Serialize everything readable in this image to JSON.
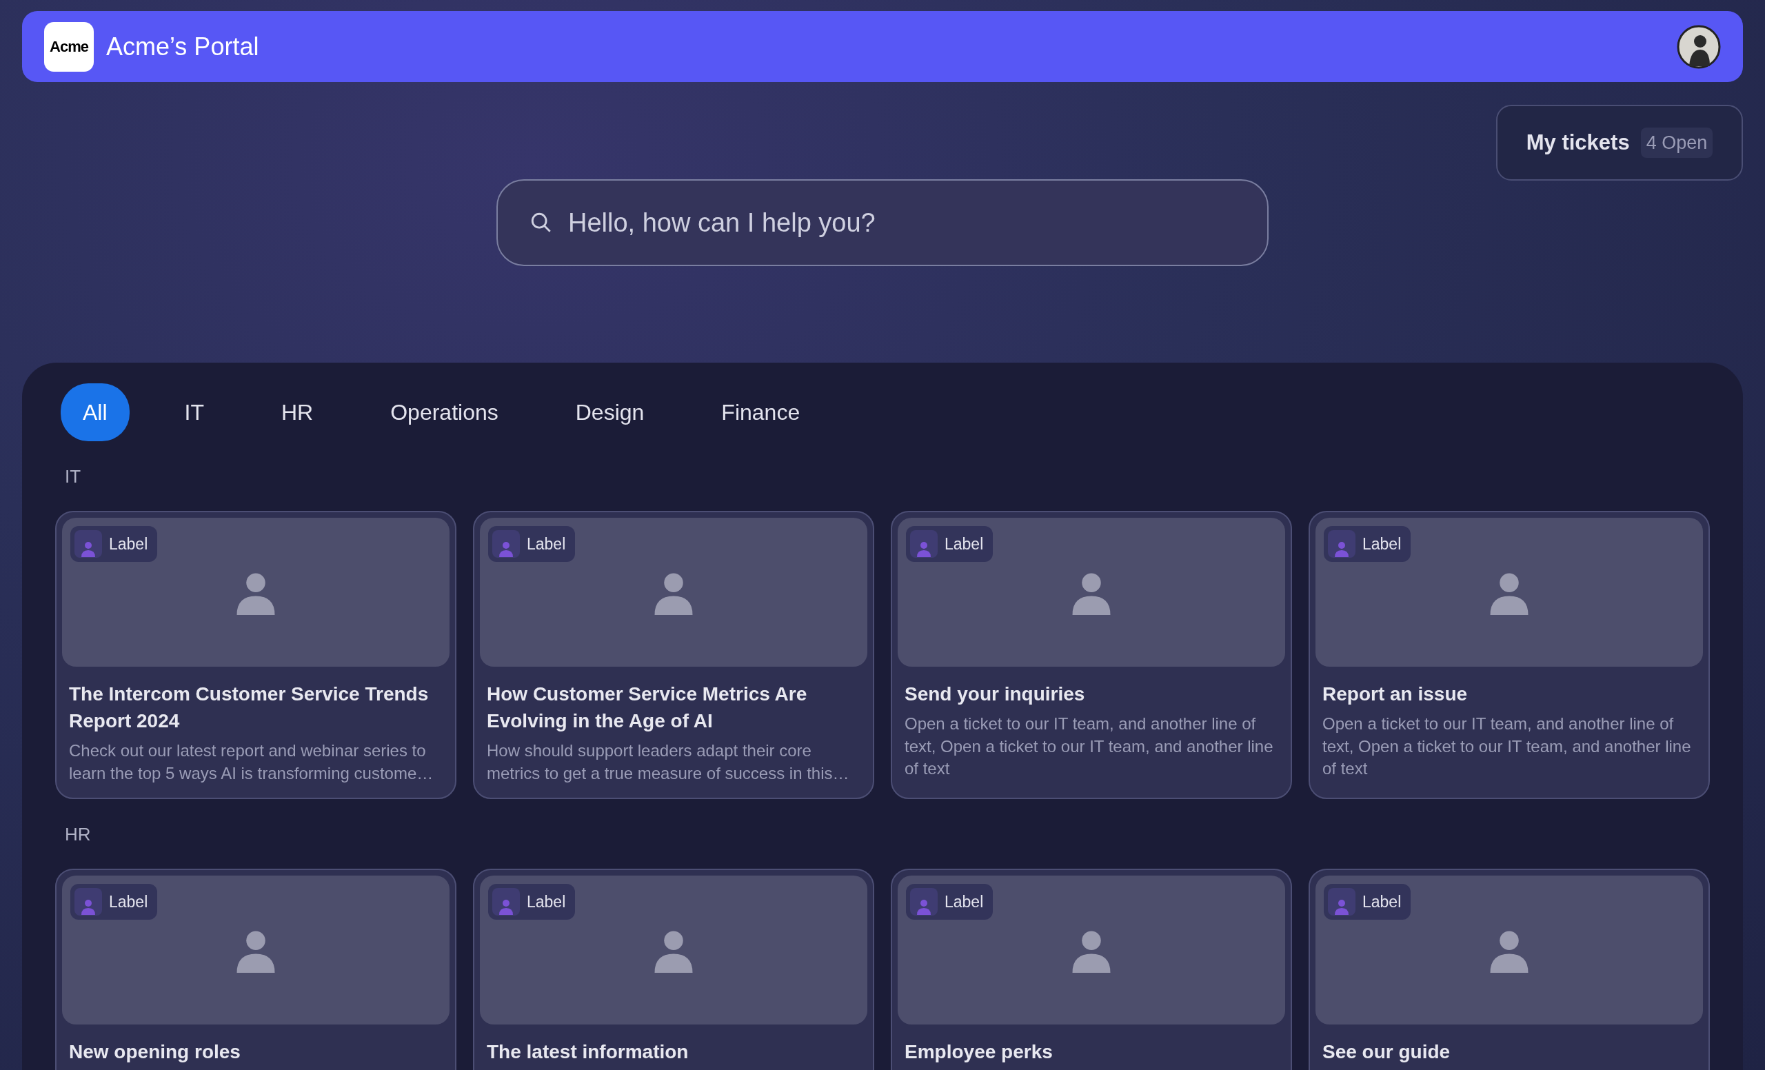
{
  "header": {
    "logo": "Acme",
    "title": "Acme’s Portal"
  },
  "tickets": {
    "label": "My tickets",
    "count": "4 Open"
  },
  "search": {
    "placeholder": "Hello, how can I help you?"
  },
  "tabs": [
    {
      "label": "All",
      "selected": true
    },
    {
      "label": "IT",
      "selected": false
    },
    {
      "label": "HR",
      "selected": false
    },
    {
      "label": "Operations",
      "selected": false
    },
    {
      "label": "Design",
      "selected": false
    },
    {
      "label": "Finance",
      "selected": false
    }
  ],
  "sections": [
    {
      "title": "IT",
      "cards": [
        {
          "label": "Label",
          "title": "The Intercom Customer Service Trends Report 2024",
          "description": "Check out our latest report and webinar series to learn the top 5 ways AI is transforming custome…"
        },
        {
          "label": "Label",
          "title": "How Customer Service Metrics Are Evolving in the Age of AI",
          "description": "How should support leaders adapt their core metrics to get a true measure of success in this…"
        },
        {
          "label": "Label",
          "title": "Send your inquiries",
          "description": "Open a ticket to our IT team, and another line of text, Open a ticket to our IT team, and another line of text"
        },
        {
          "label": "Label",
          "title": "Report an issue",
          "description": "Open a ticket to our IT team, and another line of text, Open a ticket to our IT team, and another line of text"
        }
      ]
    },
    {
      "title": "HR",
      "cards": [
        {
          "label": "Label",
          "title": "New opening roles"
        },
        {
          "label": "Label",
          "title": "The latest information"
        },
        {
          "label": "Label",
          "title": "Employee perks"
        },
        {
          "label": "Label",
          "title": "See our guide"
        }
      ]
    }
  ]
}
